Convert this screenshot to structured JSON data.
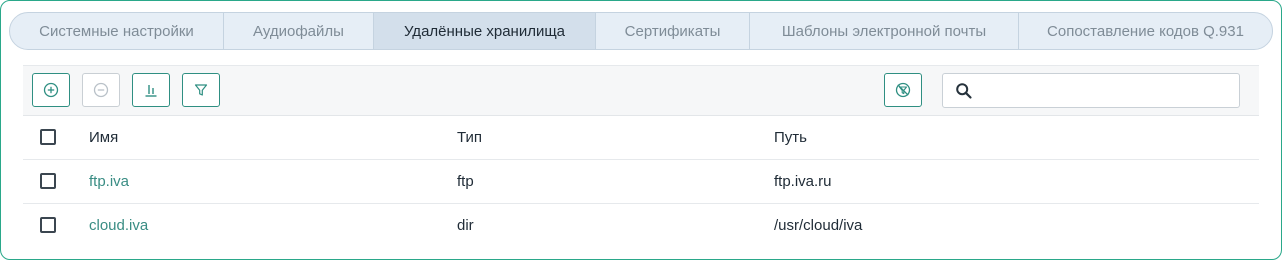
{
  "tabs": [
    {
      "label": "Системные настройки",
      "active": false
    },
    {
      "label": "Аудиофайлы",
      "active": false
    },
    {
      "label": "Удалённые хранилища",
      "active": true
    },
    {
      "label": "Сертификаты",
      "active": false
    },
    {
      "label": "Шаблоны электронной почты",
      "active": false
    },
    {
      "label": "Сопоставление кодов Q.931",
      "active": false
    }
  ],
  "toolbar": {
    "add_icon": "plus-circle-icon",
    "remove_icon": "minus-circle-icon",
    "columns_icon": "columns-chart-icon",
    "filter_icon": "filter-icon",
    "reset_filter_icon": "filter-off-icon",
    "search_icon": "search-icon",
    "search_value": "",
    "search_placeholder": ""
  },
  "table": {
    "headers": {
      "name": "Имя",
      "type": "Тип",
      "path": "Путь"
    },
    "rows": [
      {
        "name": "ftp.iva",
        "type": "ftp",
        "path": "ftp.iva.ru"
      },
      {
        "name": "cloud.iva",
        "type": "dir",
        "path": "/usr/cloud/iva"
      }
    ]
  },
  "colors": {
    "accent": "#2f8f82",
    "link": "#3a8d84",
    "frame_border": "#2aa88a",
    "tab_active_bg": "#d3dfeb",
    "tab_bg": "#e6eef6"
  }
}
